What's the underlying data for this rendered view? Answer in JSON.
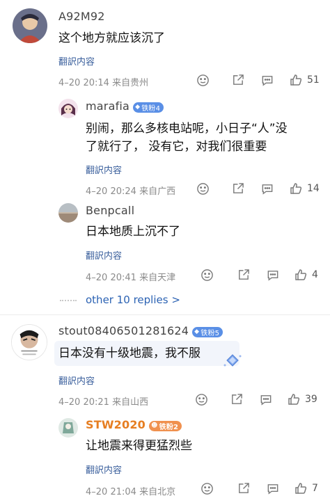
{
  "comments": [
    {
      "username": "A92M92",
      "text": "这个地方就应该沉了",
      "translate": "翻訳内容",
      "time": "4–20 20:14",
      "location": "来自贵州",
      "likes": "51",
      "replies": [
        {
          "username": "marafia",
          "badge": "铁粉4",
          "text_line1": "别闹，那么多核电站呢，小日子“人”没",
          "text_line2": "了就行了，  没有它，对我们很重要",
          "translate": "翻訳内容",
          "time": "4–20 20:24",
          "location": "来自广西",
          "likes": "14"
        },
        {
          "username": "Benpcall",
          "text": "日本地质上沉不了",
          "translate": "翻訳内容",
          "time": "4–20 20:41",
          "location": "来自天津",
          "likes": "4"
        }
      ],
      "more_replies": "other 10 replies >"
    },
    {
      "username": "stout08406501281624",
      "badge": "铁粉5",
      "text": "日本没有十级地震，我不服",
      "translate": "翻訳内容",
      "time": "4–20 20:21",
      "location": "来自山西",
      "likes": "39",
      "replies": [
        {
          "username": "STW2020",
          "badge": "铁粉2",
          "text": "让地震来得更猛烈些",
          "translate": "翻訳内容",
          "time": "4–20 21:04",
          "location": "来自北京",
          "likes": "7"
        }
      ]
    }
  ],
  "colors": {
    "link": "#3a5f9c",
    "badge_blue": "#5a8fe6",
    "badge_orange": "#f0914f",
    "name_orange": "#e67e22"
  },
  "icons": [
    "smile-icon",
    "share-icon",
    "comment-icon",
    "thumbs-up-icon"
  ]
}
